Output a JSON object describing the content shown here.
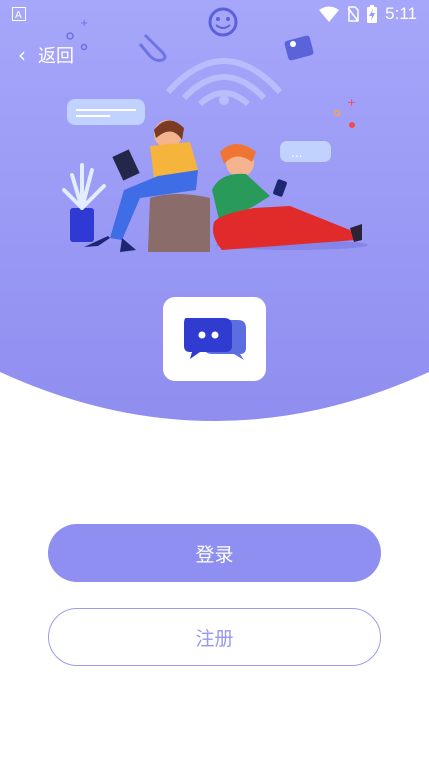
{
  "status_bar": {
    "time": "5:11",
    "icons": [
      "notification-a-icon",
      "wifi-icon",
      "no-sim-icon",
      "battery-charging-icon"
    ]
  },
  "header": {
    "back_label": "返回",
    "back_icon": "chevron-left-icon"
  },
  "hero": {
    "illustration": "two-people-chatting-illustration",
    "background_top": "#9a9cf8",
    "background_bottom": "#8f8ef0"
  },
  "app_logo": {
    "icon": "chat-bubbles-icon"
  },
  "actions": {
    "login_label": "登录",
    "register_label": "注册"
  },
  "colors": {
    "accent": "#8e8ff0",
    "button_text_light": "#ffffff",
    "outline": "#9d9cf0"
  }
}
